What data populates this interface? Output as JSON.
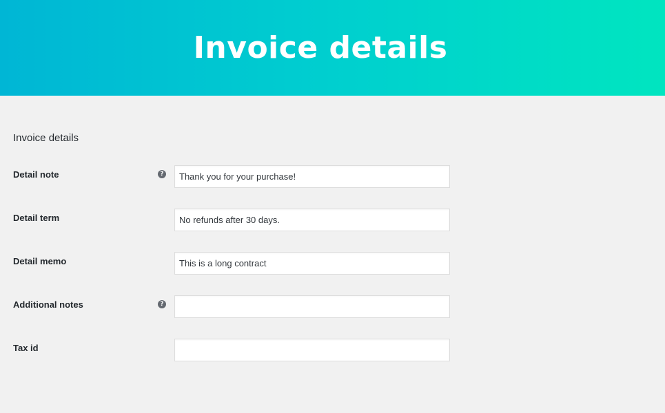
{
  "banner": {
    "title": "Invoice details"
  },
  "section": {
    "heading": "Invoice details"
  },
  "fields": [
    {
      "label": "Detail note",
      "value": "Thank you for your purchase!",
      "placeholder": "",
      "has_help": true,
      "help_icon": "question-mark-icon"
    },
    {
      "label": "Detail term",
      "value": "No refunds after 30 days.",
      "placeholder": "",
      "has_help": false
    },
    {
      "label": "Detail memo",
      "value": "This is a long contract",
      "placeholder": "",
      "has_help": false
    },
    {
      "label": "Additional notes",
      "value": "",
      "placeholder": "",
      "has_help": true,
      "help_icon": "question-mark-icon"
    },
    {
      "label": "Tax id",
      "value": "",
      "placeholder": "",
      "has_help": false
    }
  ],
  "help_glyph": "?",
  "colors": {
    "banner_gradient_start": "#00b6d5",
    "banner_gradient_end": "#00e5c0",
    "page_background": "#f1f1f1",
    "help_icon": "#646970"
  }
}
